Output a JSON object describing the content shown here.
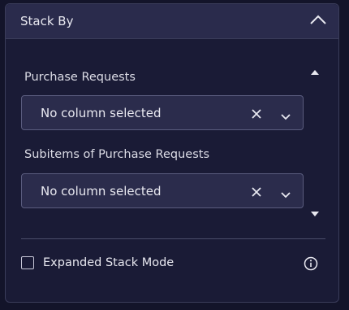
{
  "panel": {
    "title": "Stack By",
    "groups": [
      {
        "label": "Purchase Requests",
        "value": "No column selected"
      },
      {
        "label": "Subitems of Purchase Requests",
        "value": "No column selected"
      }
    ],
    "expanded_mode_label": "Expanded Stack Mode",
    "expanded_mode_checked": false
  },
  "icons": {
    "collapse": "chevron-up-icon",
    "clear": "close-icon",
    "dropdown": "chevron-down-icon",
    "scroll_up": "triangle-up-icon",
    "scroll_down": "triangle-down-icon",
    "info": "info-icon"
  },
  "colors": {
    "background": "#13142a",
    "panel": "#1a1b36",
    "header": "#2a2b4c",
    "select": "#2b2c4c",
    "border": "#5a5c7e",
    "text": "#e8e8f0"
  }
}
